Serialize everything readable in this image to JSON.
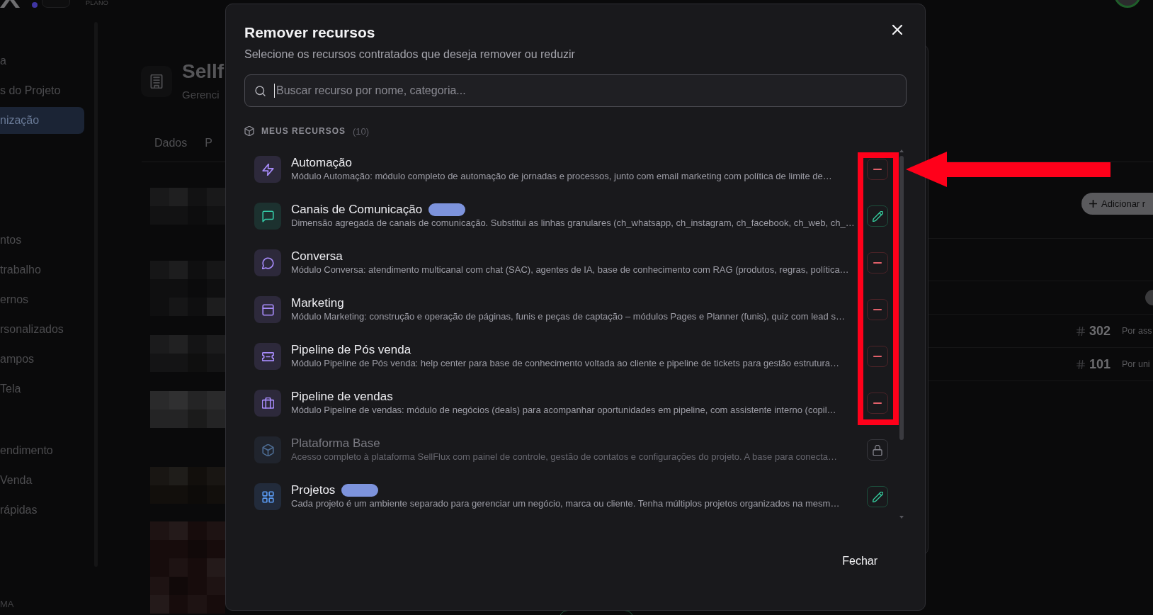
{
  "app": {
    "topbar": {
      "plan_label": "PLANO"
    },
    "sidebar": {
      "groups": [
        {
          "items": [
            {
              "label": "a",
              "selected": false
            },
            {
              "label": "s do Projeto",
              "selected": false
            },
            {
              "label": "nização",
              "selected": true
            }
          ]
        },
        {
          "items": [
            {
              "label": "ntos",
              "selected": false
            },
            {
              "label": "trabalho",
              "selected": false
            },
            {
              "label": "ernos",
              "selected": false
            },
            {
              "label": "rsonalizados",
              "selected": false
            },
            {
              "label": "ampos",
              "selected": false
            },
            {
              "label": "Tela",
              "selected": false
            }
          ]
        },
        {
          "items": [
            {
              "label": "endimento",
              "selected": false
            },
            {
              "label": "Venda",
              "selected": false
            },
            {
              "label": "rápidas",
              "selected": false
            }
          ]
        }
      ],
      "footer": "MA"
    },
    "page": {
      "title": "Sellf",
      "subtitle": "Gerenci",
      "tabs": [
        {
          "label": "Dados"
        },
        {
          "label": "P"
        }
      ],
      "add_button": "Adicionar r",
      "toggle": {
        "on": false
      },
      "rows": [
        {
          "number": "302",
          "label": "Por ass"
        },
        {
          "number": "101",
          "label": "Por uni"
        }
      ]
    }
  },
  "modal": {
    "title": "Remover recursos",
    "subtitle": "Selecione os recursos contratados que deseja remover ou reduzir",
    "search": {
      "placeholder": "Buscar recurso por nome, categoria...",
      "focused": true
    },
    "section": {
      "title": "MEUS RECURSOS",
      "count": "(10)"
    },
    "resources": [
      {
        "name": "Automação",
        "description": "Módulo Automação: módulo completo de automação de jornadas e processos, junto com email marketing com política de limite de…",
        "color": "#a78bfa",
        "kind": "remove",
        "badge": false,
        "disabled": false
      },
      {
        "name": "Canais de Comunicação",
        "description": "Dimensão agregada de canais de comunicação. Substitui as linhas granulares (ch_whatsapp, ch_instagram, ch_facebook, ch_web, ch_…",
        "color": "#34c9a6",
        "kind": "edit",
        "badge": true,
        "disabled": false
      },
      {
        "name": "Conversa",
        "description": "Módulo Conversa: atendimento multicanal com chat (SAC), agentes de IA, base de conhecimento com RAG (produtos, regras, política…",
        "color": "#a78bfa",
        "kind": "remove",
        "badge": false,
        "disabled": false
      },
      {
        "name": "Marketing",
        "description": "Módulo Marketing: construção e operação de páginas, funis e peças de captação – módulos Pages e Planner (funis), quiz com lead s…",
        "color": "#a78bfa",
        "kind": "remove",
        "badge": false,
        "disabled": false
      },
      {
        "name": "Pipeline de Pós venda",
        "description": "Módulo Pipeline de Pós venda: help center para base de conhecimento voltada ao cliente e pipeline de tickets para gestão estrutura…",
        "color": "#a78bfa",
        "kind": "remove",
        "badge": false,
        "disabled": false
      },
      {
        "name": "Pipeline de vendas",
        "description": "Módulo Pipeline de vendas: módulo de negócios (deals) para acompanhar oportunidades em pipeline, com assistente interno (copil…",
        "color": "#a78bfa",
        "kind": "remove",
        "badge": false,
        "disabled": false
      },
      {
        "name": "Plataforma Base",
        "description": "Acesso completo à plataforma SellFlux com painel de controle, gestão de contatos e configurações do projeto. A base para conecta…",
        "color": "#4d6c93",
        "kind": "locked",
        "badge": false,
        "disabled": true
      },
      {
        "name": "Projetos",
        "description": "Cada projeto é um ambiente separado para gerenciar um negócio, marca ou cliente. Tenha múltiplos projetos organizados na mesm…",
        "color": "#5b9cf5",
        "kind": "edit",
        "badge": true,
        "disabled": false
      }
    ],
    "close_button": "Fechar"
  },
  "annotation": {
    "highlight_frame": true,
    "arrow": true
  }
}
